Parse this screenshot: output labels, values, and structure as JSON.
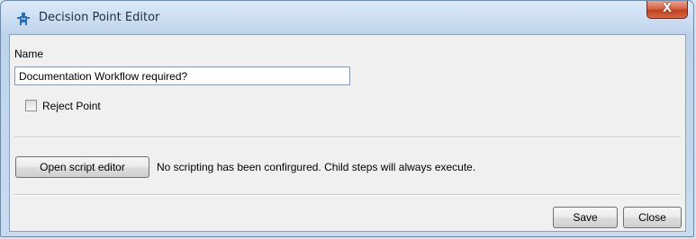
{
  "window": {
    "title": "Decision Point Editor",
    "close_glyph": "X",
    "app_icon": "gear-robot-icon"
  },
  "form": {
    "name_label": "Name",
    "name_value": "Documentation Workflow required?",
    "reject_label": "Reject Point",
    "reject_checked": false,
    "script_button_label": "Open script editor",
    "script_message": "No scripting has been confirgured.  Child steps will always execute."
  },
  "footer": {
    "save_label": "Save",
    "close_label": "Close"
  },
  "colors": {
    "titlebar": "#c5d8ee",
    "close_button": "#c2401f",
    "panel": "#f0f0f0"
  }
}
